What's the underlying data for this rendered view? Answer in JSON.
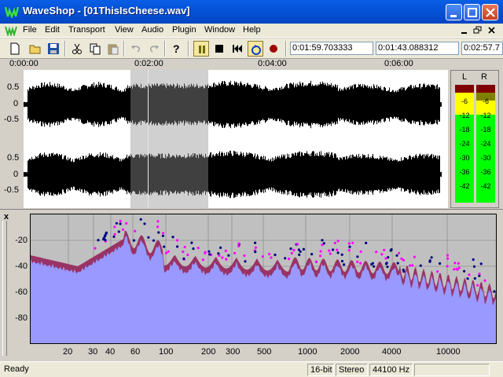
{
  "window": {
    "title": "WaveShop - [01ThisIsCheese.wav]"
  },
  "menu": {
    "items": [
      "File",
      "Edit",
      "Transport",
      "View",
      "Audio",
      "Plugin",
      "Window",
      "Help"
    ]
  },
  "toolbar": {
    "fields": {
      "cursor_time": "0:01:59.703333",
      "selection_time": "0:01:43.088312",
      "length_time": "0:02:57.7"
    }
  },
  "timeline": {
    "labels": [
      "0:00:00",
      "0:02:00",
      "0:04:00",
      "0:06:00"
    ]
  },
  "waveform": {
    "channel_axis_labels": [
      "0.5",
      "0",
      "-0.5"
    ],
    "selection_color": "#c0c0c0",
    "wave_color": "#000000"
  },
  "meters": {
    "left_label": "L",
    "right_label": "R",
    "scale": [
      "-6",
      "-12",
      "-18",
      "-24",
      "-30",
      "-36",
      "-42"
    ],
    "colors": {
      "green": "#00ff00",
      "yellow": "#ffff00",
      "red": "#c00000"
    }
  },
  "spectrum": {
    "close_label": "x",
    "y_labels": [
      "-20",
      "-40",
      "-60",
      "-80"
    ],
    "x_labels": [
      "20",
      "30",
      "40",
      "60",
      "100",
      "200",
      "300",
      "500",
      "1000",
      "2000",
      "4000",
      "10000"
    ],
    "fill_color": "#9999ff",
    "peak_color": "#993366",
    "dot_color_left": "#000080",
    "dot_color_right": "#ff00ff"
  },
  "status": {
    "text": "Ready",
    "bit_depth": "16-bit",
    "channels": "Stereo",
    "sample_rate": "44100 Hz"
  }
}
